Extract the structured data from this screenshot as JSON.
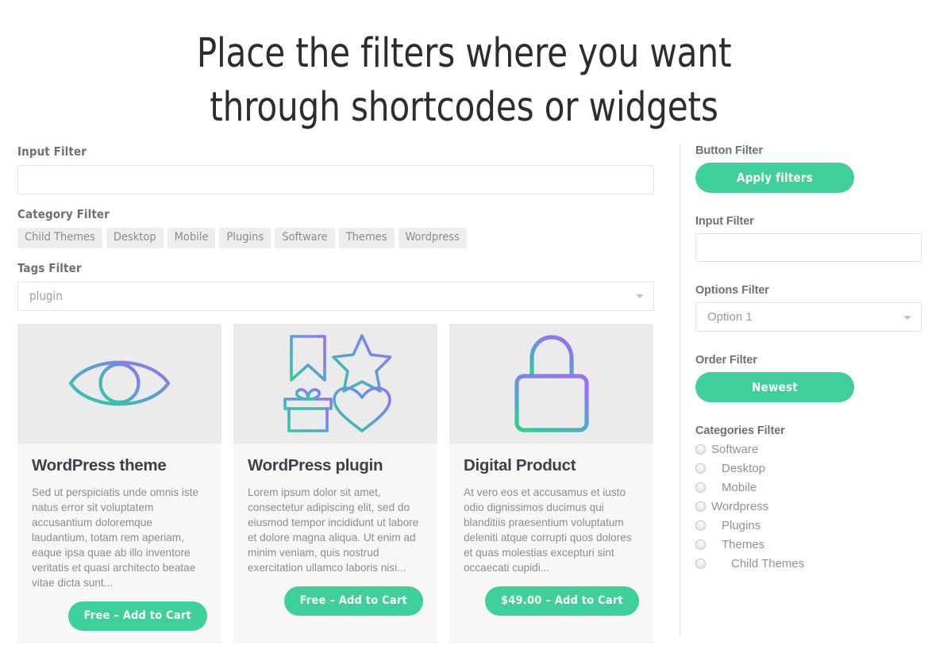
{
  "hero": {
    "line1": "Place the filters where you want",
    "line2": "through shortcodes or widgets"
  },
  "colors": {
    "accent_green": "#3ecf9a",
    "label_grey": "#6b7177",
    "pill_bg": "#ededed",
    "card_bg": "#f7f7f7",
    "card_image_bg": "#ebebeb",
    "icon_gradient_from": "#9b6ef3",
    "icon_gradient_to": "#2fcc9a"
  },
  "main_filters": {
    "input_filter": {
      "label": "Input Filter",
      "value": "",
      "placeholder": ""
    },
    "category_filter": {
      "label": "Category Filter",
      "pills": [
        "Child Themes",
        "Desktop",
        "Mobile",
        "Plugins",
        "Software",
        "Themes",
        "Wordpress"
      ]
    },
    "tags_filter": {
      "label": "Tags Filter",
      "value": "plugin",
      "caret_icon": "chevron-down-icon"
    }
  },
  "products": [
    {
      "icon": "eye-icon",
      "title": "WordPress theme",
      "description": "Sed ut perspiciatis unde omnis iste natus error sit voluptatem accusantium doloremque laudantium, totam rem aperiam, eaque ipsa quae ab illo inventore veritatis et quasi architecto beatae vitae dicta sunt...",
      "button": "Free – Add to Cart",
      "price": "Free"
    },
    {
      "icon": "bookmark-star-gift-heart-icon",
      "title": "WordPress plugin",
      "description": "Lorem ipsum dolor sit amet, consectetur adipiscing elit, sed do eiusmod tempor incididunt ut labore et dolore magna aliqua. Ut enim ad minim veniam, quis nostrud exercitation ullamco laboris nisi...",
      "button": "Free – Add to Cart",
      "price": "Free"
    },
    {
      "icon": "lock-icon",
      "title": "Digital Product",
      "description": "At vero eos et accusamus et iusto odio dignissimos ducimus qui blanditiis praesentium voluptatum deleniti atque corrupti quos dolores et quas molestias excepturi sint occaecati cupidi...",
      "button": "$49.00 – Add to Cart",
      "price": "$49.00"
    }
  ],
  "sidebar": {
    "button_filter": {
      "label": "Button Filter",
      "button": "Apply filters"
    },
    "input_filter": {
      "label": "Input Filter",
      "value": "",
      "placeholder": ""
    },
    "options_filter": {
      "label": "Options Filter",
      "value": "Option 1",
      "caret_icon": "chevron-down-icon"
    },
    "order_filter": {
      "label": "Order Filter",
      "button": "Newest"
    },
    "categories_filter": {
      "label": "Categories Filter",
      "items": [
        {
          "label": "Software",
          "level": 0,
          "selected": false
        },
        {
          "label": "Desktop",
          "level": 1,
          "selected": false
        },
        {
          "label": "Mobile",
          "level": 1,
          "selected": false
        },
        {
          "label": "Wordpress",
          "level": 0,
          "selected": false
        },
        {
          "label": "Plugins",
          "level": 1,
          "selected": false
        },
        {
          "label": "Themes",
          "level": 1,
          "selected": false
        },
        {
          "label": "Child Themes",
          "level": 2,
          "selected": false
        }
      ]
    }
  }
}
